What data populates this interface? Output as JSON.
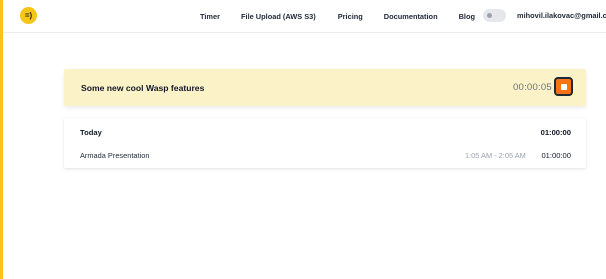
{
  "header": {
    "logo_text": "=)",
    "nav": [
      {
        "label": "Timer"
      },
      {
        "label": "File Upload (AWS S3)"
      },
      {
        "label": "Pricing"
      },
      {
        "label": "Documentation"
      },
      {
        "label": "Blog"
      }
    ],
    "user_email": "mihovil.ilakovac@gmail.com",
    "dark_mode_toggle": {
      "icon": "toggle-switch-icon",
      "state": "off"
    }
  },
  "timer": {
    "task_title": "Some new cool Wasp features",
    "elapsed": "00:00:05",
    "stop_icon": "stop-icon"
  },
  "entries": {
    "group_label": "Today",
    "group_total": "01:00:00",
    "items": [
      {
        "name": "Armada Presentation",
        "time_range": "1:05 AM - 2:05 AM",
        "duration": "01:00:00"
      }
    ]
  },
  "colors": {
    "accent": "#f5c518",
    "timer_card_bg": "#fcf2c8",
    "stop_button": "#f97316"
  }
}
